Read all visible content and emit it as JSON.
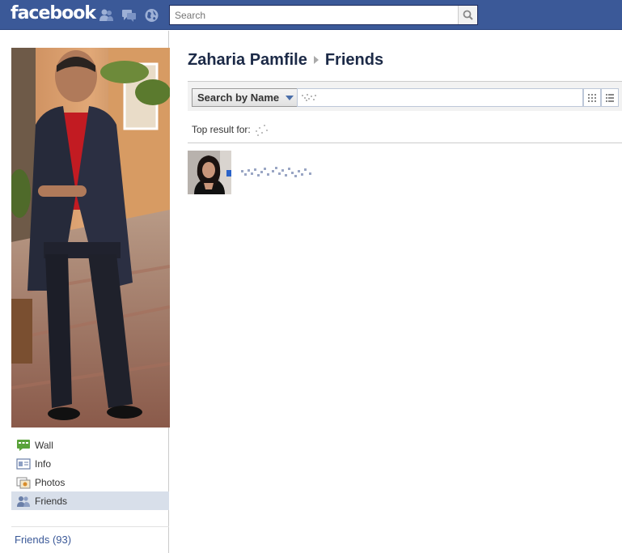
{
  "topbar": {
    "logo": "facebook",
    "search_placeholder": "Search",
    "jewels": [
      "friend-requests-icon",
      "messages-icon",
      "notifications-icon"
    ],
    "color": "#3b5998"
  },
  "profile": {
    "name": "Zaharia Pamfile",
    "section": "Friends"
  },
  "sidebar": {
    "items": [
      {
        "label": "Wall",
        "icon": "wall-icon",
        "selected": false
      },
      {
        "label": "Info",
        "icon": "info-icon",
        "selected": false
      },
      {
        "label": "Photos",
        "icon": "photos-icon",
        "selected": false
      },
      {
        "label": "Friends",
        "icon": "friends-icon",
        "selected": true
      }
    ],
    "friends_count_label": "Friends (93)"
  },
  "friends_toolbar": {
    "filter_label": "Search by Name",
    "search_value": "",
    "views": [
      "grid-view-icon",
      "list-view-icon"
    ]
  },
  "results": {
    "top_result_label": "Top result for:"
  }
}
